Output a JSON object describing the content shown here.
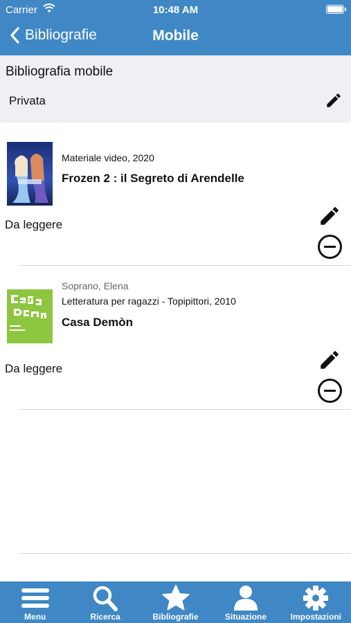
{
  "status_bar": {
    "carrier": "Carrier",
    "time": "10:48 AM"
  },
  "nav": {
    "back_label": "Bibliografie",
    "title": "Mobile"
  },
  "bibliography": {
    "name": "Bibliografia mobile",
    "visibility": "Privata"
  },
  "items": [
    {
      "author": "",
      "material": "Materiale video, 2020",
      "title": "Frozen 2 : il Segreto di Arendelle",
      "status": "Da leggere",
      "cover_icon": "movie-poster"
    },
    {
      "author": "Soprano, Elena",
      "material": "Letteratura per ragazzi - Topipittori, 2010",
      "title": "Casa Demòn",
      "status": "Da leggere",
      "cover_icon": "book-cover",
      "cover_text": "Casa Demòn"
    }
  ],
  "tabs": [
    {
      "label": "Menu",
      "icon": "menu-icon"
    },
    {
      "label": "Ricerca",
      "icon": "search-icon"
    },
    {
      "label": "Bibliografie",
      "icon": "star-icon"
    },
    {
      "label": "Situazione",
      "icon": "user-icon"
    },
    {
      "label": "Impostazioni",
      "icon": "gear-icon"
    }
  ],
  "colors": {
    "accent": "#3f88c5",
    "header_bg": "#efeff4",
    "text": "#111111",
    "secondary_text": "#666666"
  }
}
